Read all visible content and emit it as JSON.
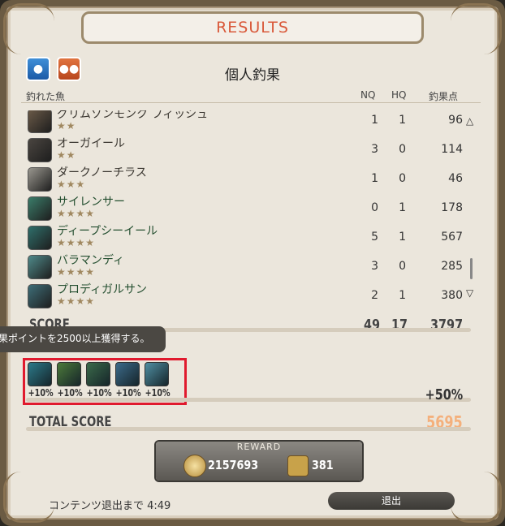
{
  "title": "RESULTS",
  "tabs": [
    {
      "icon": "person-icon",
      "active": true
    },
    {
      "icon": "party-icon",
      "active": false
    }
  ],
  "heading": "個人釣果",
  "columns": {
    "fish": "釣れた魚",
    "nq": "NQ",
    "hq": "HQ",
    "points": "釣果点"
  },
  "fish": [
    {
      "name": "グリムゾンモンク フィッシュ",
      "stars": "★★",
      "nq": "1",
      "hq": "1",
      "points": "96"
    },
    {
      "name": "オーガイール",
      "stars": "★★",
      "nq": "3",
      "hq": "0",
      "points": "114"
    },
    {
      "name": "ダークノーチラス",
      "stars": "★★★",
      "nq": "1",
      "hq": "0",
      "points": "46"
    },
    {
      "name": "サイレンサー",
      "stars": "★★★★",
      "nq": "0",
      "hq": "1",
      "points": "178"
    },
    {
      "name": "ディープシーイール",
      "stars": "★★★★",
      "nq": "5",
      "hq": "1",
      "points": "567"
    },
    {
      "name": "バラマンディ",
      "stars": "★★★★",
      "nq": "3",
      "hq": "0",
      "points": "285"
    },
    {
      "name": "プロディガルサン",
      "stars": "★★★★",
      "nq": "2",
      "hq": "1",
      "points": "380"
    }
  ],
  "score": {
    "label": "SCORE",
    "nq": "49",
    "hq": "17",
    "points": "3797"
  },
  "tooltip": "果ポイントを2500以上獲得する。",
  "bonuses": [
    {
      "label": "+10%",
      "icon": "fish-bonus-icon-1"
    },
    {
      "label": "+10%",
      "icon": "fish-bonus-icon-2"
    },
    {
      "label": "+10%",
      "icon": "fish-bonus-icon-3"
    },
    {
      "label": "+10%",
      "icon": "fish-bonus-icon-4"
    },
    {
      "label": "+10%",
      "icon": "fish-bonus-icon-5"
    }
  ],
  "bonus_total": "+50%",
  "total": {
    "label": "TOTAL SCORE",
    "value": "5695"
  },
  "reward": {
    "title": "REWARD",
    "gil": "2157693",
    "mgp": "381"
  },
  "footer": {
    "timer_text": "コンテンツ退出まで 4:49",
    "exit_label": "退出"
  },
  "colors": {
    "title": "#d9593a",
    "total": "#f4b07c",
    "highlight_box": "#e01a2e",
    "fish_name": "#234e2f"
  }
}
